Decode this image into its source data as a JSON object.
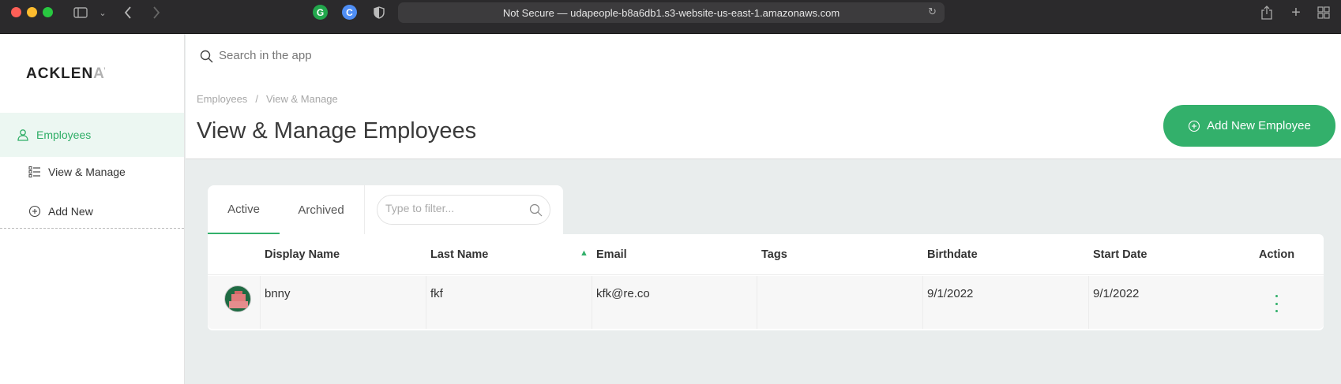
{
  "browser": {
    "url_text": "Not Secure — udapeople-b8a6db1.s3-website-us-east-1.amazonaws.com"
  },
  "sidebar": {
    "logo": "ACKLEN",
    "logo_faded": "AV",
    "items": [
      {
        "label": "Employees",
        "icon": "user-icon"
      },
      {
        "label": "View & Manage",
        "icon": "list-icon"
      },
      {
        "label": "Add New",
        "icon": "plus-circle-icon"
      }
    ]
  },
  "topbar": {
    "search_placeholder": "Search in the app"
  },
  "header": {
    "breadcrumb": [
      "Employees",
      "View & Manage"
    ],
    "title": "View & Manage Employees",
    "add_button_label": "Add New Employee"
  },
  "tabs": {
    "active_label": "Active",
    "archived_label": "Archived",
    "filter_placeholder": "Type to filter..."
  },
  "table": {
    "columns": [
      "Display Name",
      "Last Name",
      "Email",
      "Tags",
      "Birthdate",
      "Start Date",
      "Action"
    ],
    "sorted_column": "Email",
    "rows": [
      {
        "display_name": "bnny",
        "last_name": "fkf",
        "email": "kfk@re.co",
        "tags": "",
        "birthdate": "9/1/2022",
        "start_date": "9/1/2022"
      }
    ]
  },
  "colors": {
    "accent": "#33b06b",
    "sidebar_active_bg": "#ecf7f2",
    "page_bg": "#e9eded"
  }
}
